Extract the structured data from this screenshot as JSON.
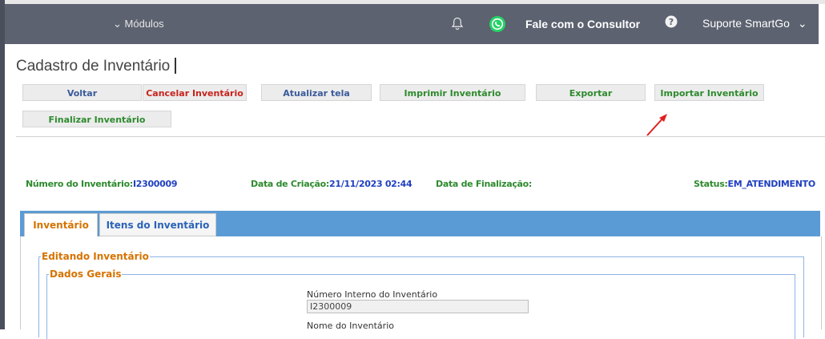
{
  "header": {
    "modules_label": "Módulos",
    "consultant_label": "Fale com o Consultor",
    "support_label": "Suporte SmartGo",
    "colors": {
      "bar": "#5c6270",
      "whatsapp": "#25d366"
    }
  },
  "page": {
    "title": "Cadastro de Inventário"
  },
  "toolbar": {
    "voltar": "Voltar",
    "cancelar": "Cancelar Inventário",
    "atualizar": "Atualizar tela",
    "imprimir": "Imprimir Inventário",
    "exportar": "Exportar",
    "importar": "Importar Inventário",
    "finalizar": "Finalizar Inventário"
  },
  "info": {
    "numero_label": "Número do Inventário:",
    "numero_value": "I2300009",
    "criacao_label": "Data de Criação:",
    "criacao_value": "21/11/2023 02:44",
    "finalizacao_label": "Data de Finalização:",
    "finalizacao_value": "",
    "status_label": "Status:",
    "status_value": "EM_ATENDIMENTO"
  },
  "tabs": [
    {
      "label": "Inventário",
      "active": true
    },
    {
      "label": "Itens do Inventário",
      "active": false
    }
  ],
  "form": {
    "fieldset_outer": "Editando Inventário",
    "fieldset_inner": "Dados Gerais",
    "numero_interno_label": "Número Interno do Inventário",
    "numero_interno_value": "I2300009",
    "nome_label": "Nome do Inventário"
  }
}
